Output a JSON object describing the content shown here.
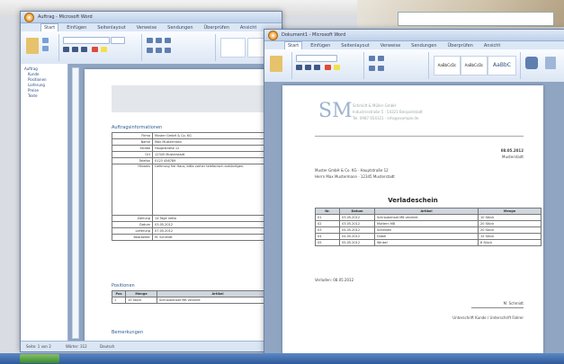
{
  "desktop": {
    "search_placeholder": ""
  },
  "left_window": {
    "title": "Auftrag - Microsoft Word",
    "tabs": [
      "Start",
      "Einfügen",
      "Seitenlayout",
      "Verweise",
      "Sendungen",
      "Überprüfen",
      "Ansicht"
    ],
    "nav_items": [
      "Auftrag",
      "Kunde",
      "Positionen",
      "Lieferung",
      "Preise",
      "Texte"
    ],
    "heading": "Auftragsinformationen",
    "info_rows": [
      [
        "Firma",
        "Muster GmbH & Co. KG"
      ],
      [
        "Name",
        "Max Mustermann"
      ],
      [
        "Straße",
        "Hauptstraße 12"
      ],
      [
        "Ort",
        "12345 Musterstadt"
      ],
      [
        "Telefon",
        "0123 456789"
      ],
      [
        "Hinweis",
        "Lieferung frei Haus, bitte vorher telefonisch ankündigen."
      ],
      [
        "Zahlung",
        "14 Tage netto"
      ],
      [
        "Datum",
        "03.05.2012"
      ],
      [
        "Lieferung",
        "07.05.2012"
      ],
      [
        "Bearbeiter",
        "M. Schmidt"
      ]
    ],
    "section2": "Positionen",
    "pos_header": [
      "Pos",
      "Menge",
      "Artikel"
    ],
    "pos_rows": [
      [
        "1",
        "10 Stück",
        "Schraubenset M8 verzinkt"
      ]
    ],
    "section3": "Bemerkungen",
    "status_items": [
      "Seite: 1 von 2",
      "Wörter: 312",
      "Deutsch"
    ]
  },
  "right_window": {
    "title": "Dokument1 - Microsoft Word",
    "tabs": [
      "Start",
      "Einfügen",
      "Seitenlayout",
      "Verweise",
      "Sendungen",
      "Überprüfen",
      "Ansicht"
    ],
    "styles": [
      "AaBbCcDc",
      "AaBbCcDc",
      "AaBbC"
    ],
    "logo": "SM",
    "logo_lines": [
      "Schmidt & Müller GmbH",
      "Industriestraße 5 · 54321 Beispielstadt",
      "Tel. 0987 654321 · info@example.de"
    ],
    "date": "08.05.2012",
    "date_sub": "Musterstadt",
    "address": [
      "Muster GmbH & Co. KG · Hauptstraße 12",
      "Herrn Max Mustermann · 12345 Musterstadt"
    ],
    "doc_title": "Verladeschein",
    "table_header": [
      "Nr.",
      "Datum",
      "Artikel",
      "Menge"
    ],
    "table_rows": [
      [
        "01",
        "03.05.2012",
        "Schraubenset M8 verzinkt",
        "10 Stück"
      ],
      [
        "02",
        "03.05.2012",
        "Muttern M8",
        "20 Stück"
      ],
      [
        "03",
        "04.05.2012",
        "Scheiben",
        "20 Stück"
      ],
      [
        "04",
        "04.05.2012",
        "Dübel",
        "15 Stück"
      ],
      [
        "05",
        "05.05.2012",
        "Winkel",
        "8 Stück"
      ]
    ],
    "footer_note": "Verladen: 08.05.2012",
    "sign_name": "M. Schmidt",
    "sign_line": "Unterschrift Kunde / Unterschrift Fahrer"
  }
}
